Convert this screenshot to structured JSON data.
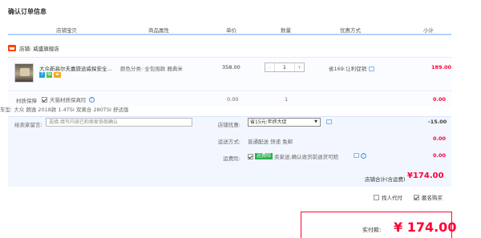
{
  "page_title": "确认订单信息",
  "columns": [
    "店铺宝贝",
    "商品属性",
    "单价",
    "数量",
    "优惠方式",
    "小计"
  ],
  "shop": {
    "label": "店铺: 威盛旗舰店"
  },
  "item": {
    "name": "大众新高尔夫嘉旅途威探安全...",
    "attribute": "颜色分类: 全包围款 雅典米",
    "unit_price": "358.00",
    "quantity": "1",
    "promo": "省169:让利促销",
    "subtotal": "189.00"
  },
  "service": {
    "label": "材质保障",
    "option": "天猫材质保真险",
    "price": "0.00",
    "quantity": "1",
    "subtotal": "0.00"
  },
  "car_type": "车型: 大众 朗逸 2018款 1.4TSI 双离合 280TSI 舒适版",
  "message": {
    "label": "给卖家留言:",
    "placeholder": "选填:填写内容已和卖家协商确认"
  },
  "store_discount": {
    "label": "店铺优惠:",
    "selected": "省15元:年终大促",
    "amount": "-15.00"
  },
  "shipping": {
    "label": "运送方式:",
    "value": "普通配送 快递 免邮",
    "amount": "0.00"
  },
  "insurance": {
    "label": "运费险:",
    "tag": "运费险",
    "value": "卖家送,确认收货前退货可赔",
    "amount": "0.00"
  },
  "store_total": {
    "label": "店铺合计(含运费)",
    "amount": "¥174.00"
  },
  "options": {
    "proxy_pay": "找人代付",
    "anonymous": "匿名购买"
  },
  "payment": {
    "label": "实付款:",
    "amount": "¥ 174.00"
  },
  "colors": {
    "accent_red": "#ff0036",
    "header_border": "#b2d1ff"
  }
}
